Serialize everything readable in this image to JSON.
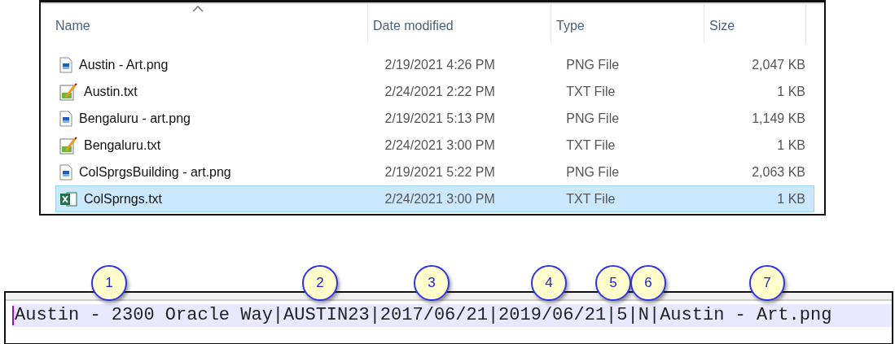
{
  "explorer": {
    "columns": [
      {
        "label": "Name",
        "sorted": true
      },
      {
        "label": "Date modified",
        "sorted": false
      },
      {
        "label": "Type",
        "sorted": false
      },
      {
        "label": "Size",
        "sorted": false
      }
    ],
    "rows": [
      {
        "kind": "image",
        "name": "Austin - Art.png",
        "date": "2/19/2021 4:26 PM",
        "type": "PNG File",
        "size": "2,047 KB",
        "selected": false
      },
      {
        "kind": "notepad",
        "name": "Austin.txt",
        "date": "2/24/2021 2:22 PM",
        "type": "TXT File",
        "size": "1 KB",
        "selected": false
      },
      {
        "kind": "image",
        "name": "Bengaluru - art.png",
        "date": "2/19/2021 5:13 PM",
        "type": "PNG File",
        "size": "1,149 KB",
        "selected": false
      },
      {
        "kind": "notepad",
        "name": "Bengaluru.txt",
        "date": "2/24/2021 3:00 PM",
        "type": "TXT File",
        "size": "1 KB",
        "selected": false
      },
      {
        "kind": "image",
        "name": "ColSprgsBuilding - art.png",
        "date": "2/19/2021 5:22 PM",
        "type": "PNG File",
        "size": "2,063 KB",
        "selected": false
      },
      {
        "kind": "spreadsheet",
        "name": "ColSprngs.txt",
        "date": "2/24/2021 3:00 PM",
        "type": "TXT File",
        "size": "1 KB",
        "selected": true
      }
    ]
  },
  "callouts": [
    "1",
    "2",
    "3",
    "4",
    "5",
    "6",
    "7"
  ],
  "editor": {
    "line": "Austin - 2300 Oracle Way|AUSTIN23|2017/06/21|2019/06/21|5|N|Austin - Art.png"
  }
}
